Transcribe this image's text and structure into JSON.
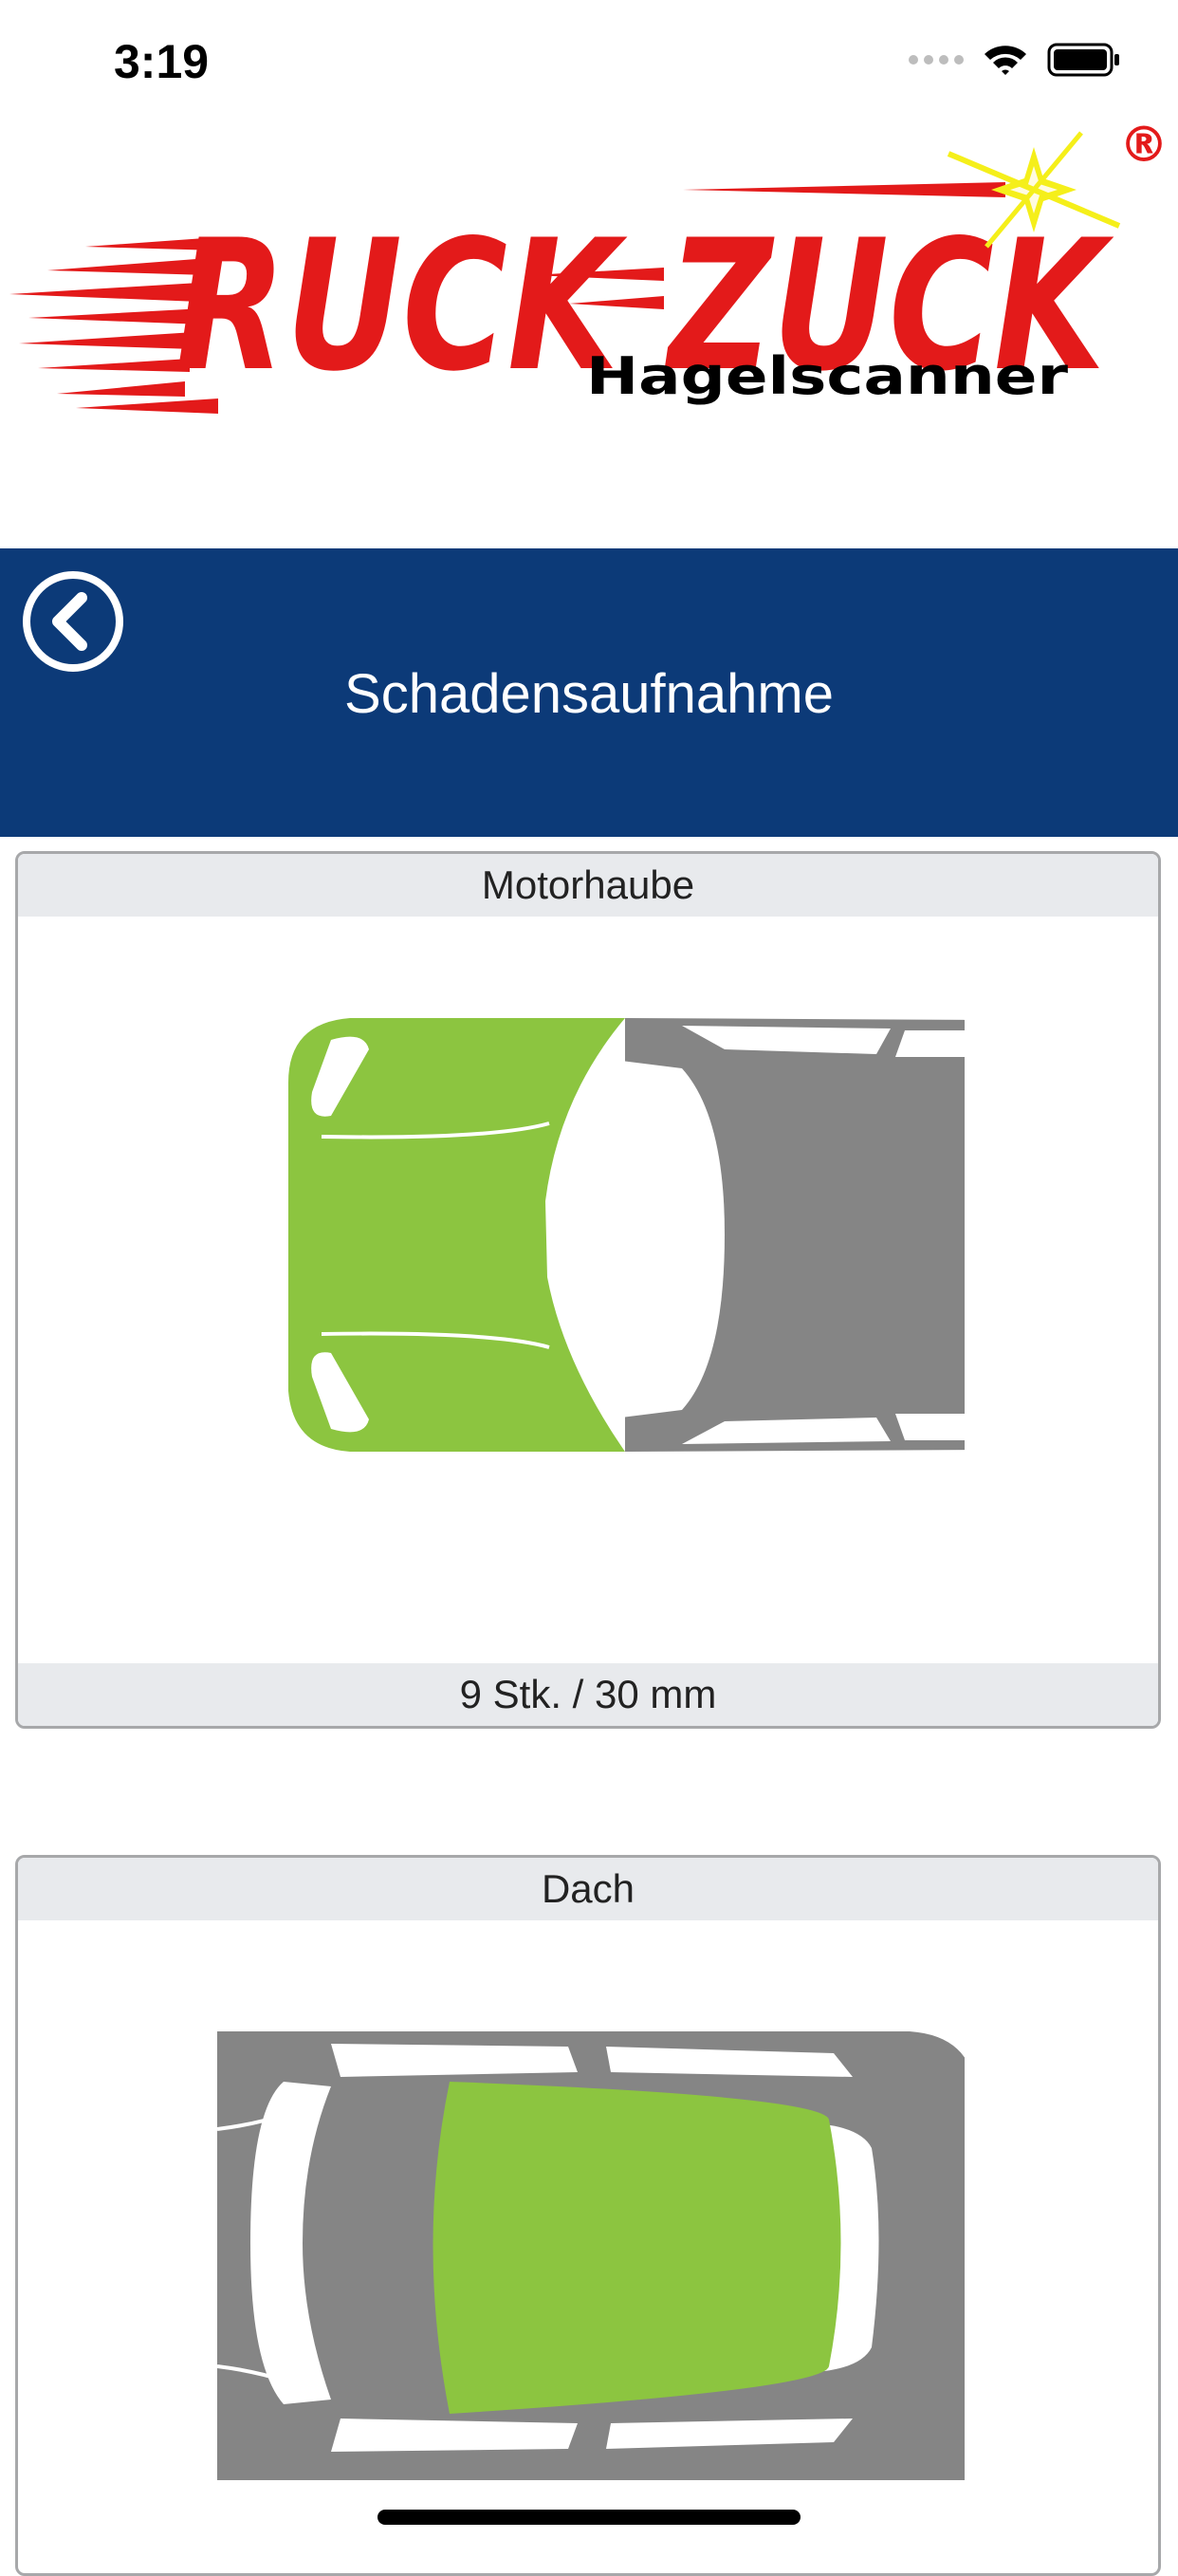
{
  "status_bar": {
    "time": "3:19"
  },
  "logo": {
    "brand": "RUCK ZUCK",
    "subtitle": "Hagelscanner",
    "registered": "®"
  },
  "header": {
    "title": "Schadensaufnahme"
  },
  "cards": [
    {
      "part": "Motorhaube",
      "summary": "9 Stk. / 30 mm"
    },
    {
      "part": "Dach",
      "summary": ""
    }
  ],
  "colors": {
    "header_bg": "#0c3a78",
    "highlight": "#8cc540",
    "car_body": "#858585",
    "logo_red": "#e31a1a",
    "card_bar": "#e8eaed"
  }
}
